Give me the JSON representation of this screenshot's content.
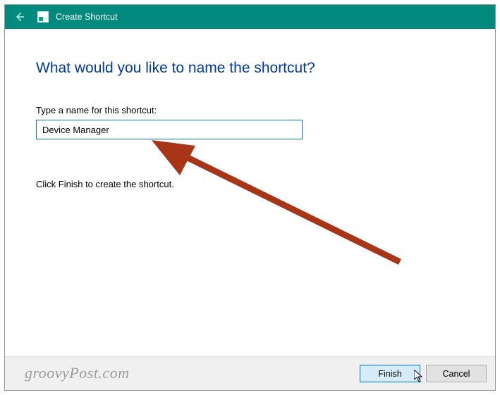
{
  "titlebar": {
    "title": "Create Shortcut"
  },
  "content": {
    "heading": "What would you like to name the shortcut?",
    "name_label": "Type a name for this shortcut:",
    "name_value": "Device Manager",
    "instruction": "Click Finish to create the shortcut."
  },
  "footer": {
    "finish_label": "Finish",
    "cancel_label": "Cancel"
  },
  "watermark": "groovyPost.com",
  "annotation": {
    "arrow_color": "#a93518"
  }
}
